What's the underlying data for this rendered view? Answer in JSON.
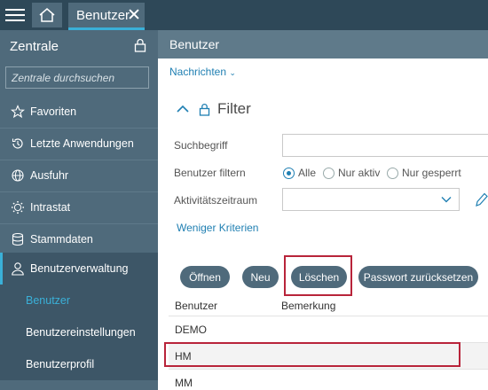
{
  "topbar": {
    "tab_label": "Benutzer"
  },
  "sidebar": {
    "title": "Zentrale",
    "search_placeholder": "Zentrale durchsuchen",
    "items": [
      {
        "label": "Favoriten",
        "icon": "star-icon"
      },
      {
        "label": "Letzte Anwendungen",
        "icon": "history-icon"
      },
      {
        "label": "Ausfuhr",
        "icon": "globe-icon"
      },
      {
        "label": "Intrastat",
        "icon": "globe-stars-icon"
      },
      {
        "label": "Stammdaten",
        "icon": "database-icon"
      },
      {
        "label": "Benutzerverwaltung",
        "icon": "user-icon"
      }
    ],
    "subitems": [
      {
        "label": "Benutzer"
      },
      {
        "label": "Benutzereinstellungen"
      },
      {
        "label": "Benutzerprofil"
      }
    ]
  },
  "main": {
    "header": "Benutzer",
    "nachrichten": "Nachrichten",
    "filter": {
      "title": "Filter",
      "suchbegriff_label": "Suchbegriff",
      "suchbegriff_value": "",
      "benutzer_filtern_label": "Benutzer filtern",
      "radio_options": [
        "Alle",
        "Nur aktiv",
        "Nur gesperrt"
      ],
      "radio_selected": "Alle",
      "aktivitaet_label": "Aktivitätszeitraum",
      "aktivitaet_value": "",
      "weniger_kriterien": "Weniger Kriterien"
    },
    "buttons": {
      "oeffnen": "Öffnen",
      "neu": "Neu",
      "loeschen": "Löschen",
      "passwort": "Passwort zurücksetzen"
    },
    "table": {
      "headers": [
        "Benutzer",
        "Bemerkung"
      ],
      "rows": [
        {
          "benutzer": "DEMO",
          "bemerkung": ""
        },
        {
          "benutzer": "HM",
          "bemerkung": ""
        },
        {
          "benutzer": "MM",
          "bemerkung": ""
        }
      ]
    }
  },
  "colors": {
    "topbar": "#2e4858",
    "sidebar": "#4f6a7b",
    "accent": "#3ab0d8",
    "link": "#1f7fb2",
    "highlight": "#b8243a"
  }
}
